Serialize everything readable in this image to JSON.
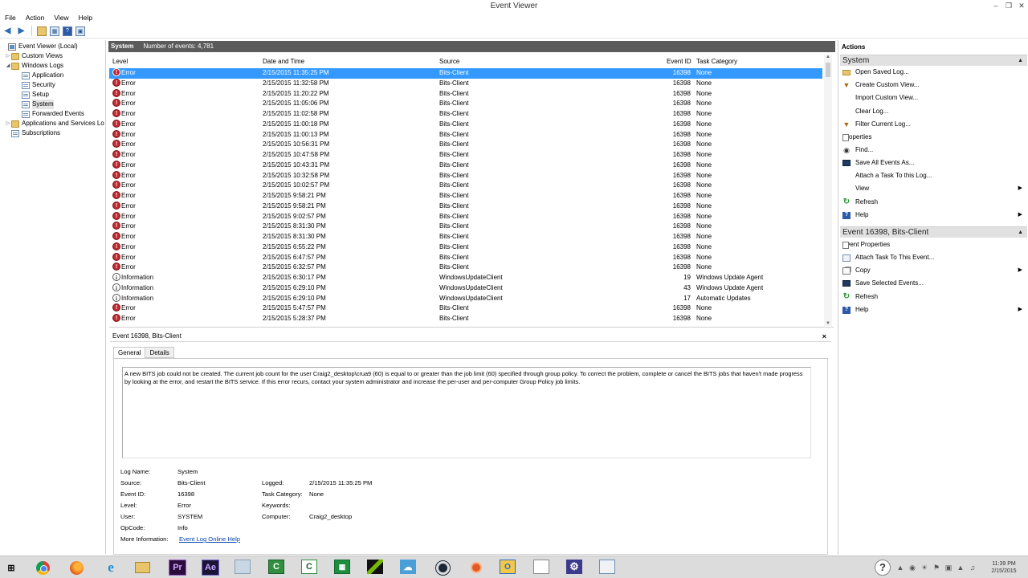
{
  "window": {
    "title": "Event Viewer",
    "controls": {
      "minimize": "–",
      "restore": "❐",
      "close": "✕"
    }
  },
  "menu": [
    "File",
    "Action",
    "View",
    "Help"
  ],
  "toolbar_icons": [
    "back-arrow-icon",
    "forward-arrow-icon",
    "open-folder-icon",
    "console-tree-icon",
    "help-icon",
    "show-pane-icon"
  ],
  "tree": {
    "root": "Event Viewer (Local)",
    "custom_views": "Custom Views",
    "windows_logs": "Windows Logs",
    "application": "Application",
    "security": "Security",
    "setup": "Setup",
    "system": "System",
    "forwarded": "Forwarded Events",
    "apps_services": "Applications and Services Lo",
    "subscriptions": "Subscriptions"
  },
  "center": {
    "log_name": "System",
    "event_count": "Number of events: 4,781"
  },
  "grid": {
    "columns": {
      "level": "Level",
      "date": "Date and Time",
      "source": "Source",
      "event_id": "Event ID",
      "task": "Task Category"
    },
    "rows": [
      {
        "level": "Error",
        "date": "2/15/2015 11:35:25 PM",
        "source": "Bits-Client",
        "id": "16398",
        "task": "None"
      },
      {
        "level": "Error",
        "date": "2/15/2015 11:32:58 PM",
        "source": "Bits-Client",
        "id": "16398",
        "task": "None"
      },
      {
        "level": "Error",
        "date": "2/15/2015 11:20:22 PM",
        "source": "Bits-Client",
        "id": "16398",
        "task": "None"
      },
      {
        "level": "Error",
        "date": "2/15/2015 11:05:06 PM",
        "source": "Bits-Client",
        "id": "16398",
        "task": "None"
      },
      {
        "level": "Error",
        "date": "2/15/2015 11:02:58 PM",
        "source": "Bits-Client",
        "id": "16398",
        "task": "None"
      },
      {
        "level": "Error",
        "date": "2/15/2015 11:00:18 PM",
        "source": "Bits-Client",
        "id": "16398",
        "task": "None"
      },
      {
        "level": "Error",
        "date": "2/15/2015 11:00:13 PM",
        "source": "Bits-Client",
        "id": "16398",
        "task": "None"
      },
      {
        "level": "Error",
        "date": "2/15/2015 10:56:31 PM",
        "source": "Bits-Client",
        "id": "16398",
        "task": "None"
      },
      {
        "level": "Error",
        "date": "2/15/2015 10:47:58 PM",
        "source": "Bits-Client",
        "id": "16398",
        "task": "None"
      },
      {
        "level": "Error",
        "date": "2/15/2015 10:43:31 PM",
        "source": "Bits-Client",
        "id": "16398",
        "task": "None"
      },
      {
        "level": "Error",
        "date": "2/15/2015 10:32:58 PM",
        "source": "Bits-Client",
        "id": "16398",
        "task": "None"
      },
      {
        "level": "Error",
        "date": "2/15/2015 10:02:57 PM",
        "source": "Bits-Client",
        "id": "16398",
        "task": "None"
      },
      {
        "level": "Error",
        "date": "2/15/2015 9:58:21 PM",
        "source": "Bits-Client",
        "id": "16398",
        "task": "None"
      },
      {
        "level": "Error",
        "date": "2/15/2015 9:58:21 PM",
        "source": "Bits-Client",
        "id": "16398",
        "task": "None"
      },
      {
        "level": "Error",
        "date": "2/15/2015 9:02:57 PM",
        "source": "Bits-Client",
        "id": "16398",
        "task": "None"
      },
      {
        "level": "Error",
        "date": "2/15/2015 8:31:30 PM",
        "source": "Bits-Client",
        "id": "16398",
        "task": "None"
      },
      {
        "level": "Error",
        "date": "2/15/2015 8:31:30 PM",
        "source": "Bits-Client",
        "id": "16398",
        "task": "None"
      },
      {
        "level": "Error",
        "date": "2/15/2015 6:55:22 PM",
        "source": "Bits-Client",
        "id": "16398",
        "task": "None"
      },
      {
        "level": "Error",
        "date": "2/15/2015 6:47:57 PM",
        "source": "Bits-Client",
        "id": "16398",
        "task": "None"
      },
      {
        "level": "Error",
        "date": "2/15/2015 6:32:57 PM",
        "source": "Bits-Client",
        "id": "16398",
        "task": "None"
      },
      {
        "level": "Information",
        "date": "2/15/2015 6:30:17 PM",
        "source": "WindowsUpdateClient",
        "id": "19",
        "task": "Windows Update Agent"
      },
      {
        "level": "Information",
        "date": "2/15/2015 6:29:10 PM",
        "source": "WindowsUpdateClient",
        "id": "43",
        "task": "Windows Update Agent"
      },
      {
        "level": "Information",
        "date": "2/15/2015 6:29:10 PM",
        "source": "WindowsUpdateClient",
        "id": "17",
        "task": "Automatic Updates"
      },
      {
        "level": "Error",
        "date": "2/15/2015 5:47:57 PM",
        "source": "Bits-Client",
        "id": "16398",
        "task": "None"
      },
      {
        "level": "Error",
        "date": "2/15/2015 5:28:37 PM",
        "source": "Bits-Client",
        "id": "16398",
        "task": "None"
      }
    ]
  },
  "detail": {
    "title": "Event 16398, Bits-Client",
    "close": "×",
    "tabs": [
      "General",
      "Details"
    ],
    "description": "A new BITS job could not be created. The current job count for the user Craig2_desktop\\crua9 (60) is equal to or greater than the job limit (60) specified through group policy.  To correct the problem, complete or cancel the BITS jobs that haven't made progress by looking at the error, and restart the BITS service. If this error recurs, contact your system administrator and increase the per-user and per-computer Group Policy job limits.",
    "labels": {
      "log_name": "Log Name:",
      "source": "Source:",
      "event_id": "Event ID:",
      "level": "Level:",
      "user": "User:",
      "opcode": "OpCode:",
      "more_info": "More Information:",
      "logged": "Logged:",
      "task_category": "Task Category:",
      "keywords": "Keywords:",
      "computer": "Computer:"
    },
    "values": {
      "log_name": "System",
      "source": "Bits-Client",
      "event_id": "16398",
      "level": "Error",
      "user": "SYSTEM",
      "opcode": "Info",
      "more_info": "Event Log Online Help",
      "logged": "2/15/2015 11:35:25 PM",
      "task_category": "None",
      "keywords": "",
      "computer": "Craig2_desktop"
    }
  },
  "actions": {
    "header": "Actions",
    "section1": "System",
    "section1_items": [
      "Open Saved Log...",
      "Create Custom View...",
      "Import Custom View...",
      "Clear Log...",
      "Filter Current Log...",
      "Properties",
      "Find...",
      "Save All Events As...",
      "Attach a Task To this Log...",
      "View",
      "Refresh",
      "Help"
    ],
    "section2": "Event 16398, Bits-Client",
    "section2_items": [
      "Event Properties",
      "Attach Task To This Event...",
      "Copy",
      "Save Selected Events...",
      "Refresh",
      "Help"
    ]
  },
  "taskbar": {
    "apps": [
      "chrome-icon",
      "firefox-icon",
      "internet-explorer-icon",
      "file-explorer-icon",
      "premiere-pro-icon",
      "after-effects-icon",
      "window-icon",
      "camtasia-icon",
      "camtasia-recorder-icon",
      "spreadsheet-icon",
      "nvidia-icon",
      "cloud-icon",
      "steam-icon",
      "orange-app-icon",
      "outlook-icon",
      "document-icon",
      "settings-icon",
      "event-viewer-icon"
    ],
    "pr_label": "Pr",
    "ae_label": "Ae",
    "clock_time": "11:39 PM",
    "clock_date": "2/15/2015"
  },
  "colors": {
    "selection": "#3399ff",
    "header_bar": "#5b5b5b",
    "error_red": "#c0282d",
    "link": "#0645ad"
  }
}
